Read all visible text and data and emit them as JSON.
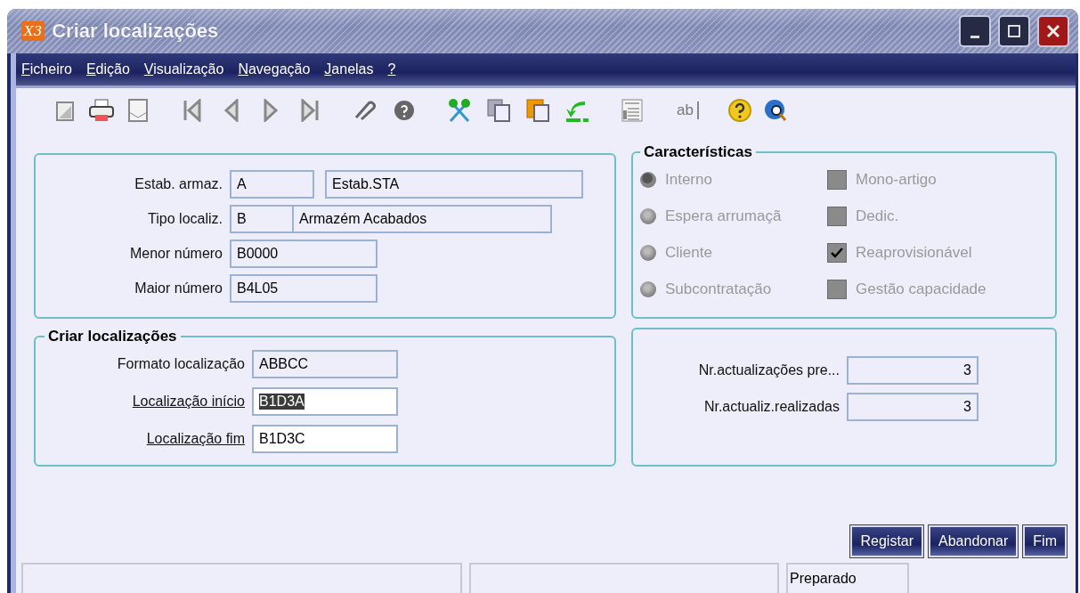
{
  "window": {
    "logo": "X3",
    "title": "Criar localizações"
  },
  "menu": [
    "Ficheiro",
    "Edição",
    "Visualização",
    "Navegação",
    "Janelas",
    "?"
  ],
  "toolbar": [
    {
      "kind": "page"
    },
    {
      "kind": "printer"
    },
    {
      "kind": "mail"
    },
    {
      "kind": "first"
    },
    {
      "kind": "prev"
    },
    {
      "kind": "next"
    },
    {
      "kind": "last"
    },
    {
      "kind": "clip"
    },
    {
      "kind": "help-grey"
    },
    {
      "kind": "scissors"
    },
    {
      "kind": "copy"
    },
    {
      "kind": "paste"
    },
    {
      "kind": "arrow"
    },
    {
      "kind": "form"
    },
    {
      "kind": "text",
      "label": "ab"
    },
    {
      "kind": "help"
    },
    {
      "kind": "globe"
    }
  ],
  "header_group": {
    "rows": [
      {
        "label": "Estab. armaz.",
        "kind": "pair",
        "values": [
          "A",
          "Estab.STA"
        ]
      },
      {
        "label": "Tipo localiz.",
        "kind": "joined",
        "values": [
          "B",
          "Armazém Acabados"
        ]
      },
      {
        "label": "Menor número",
        "kind": "single",
        "values": [
          "B0000"
        ]
      },
      {
        "label": "Maior número",
        "kind": "single",
        "values": [
          "B4L05"
        ]
      }
    ]
  },
  "characteristics": {
    "title": "Características",
    "radios": [
      {
        "label": "Interno",
        "selected": true
      },
      {
        "label": "Espera arrumaçã",
        "selected": false
      },
      {
        "label": "Cliente",
        "selected": false
      },
      {
        "label": "Subcontratação",
        "selected": false
      }
    ],
    "checkboxes": [
      {
        "label": "Mono-artigo",
        "checked": false
      },
      {
        "label": "Dedic.",
        "checked": false
      },
      {
        "label": "Reaprovisionável",
        "checked": true
      },
      {
        "label": "Gestão capacidade",
        "checked": false
      }
    ]
  },
  "create_group": {
    "title": "Criar localizações",
    "rows": [
      {
        "label": "Formato localização",
        "value": "ABBCC",
        "link": false,
        "editable": false,
        "highlighted": false
      },
      {
        "label": "Localização início",
        "value": "B1D3A",
        "link": true,
        "editable": true,
        "highlighted": true
      },
      {
        "label": "Localização fim",
        "value": "B1D3C",
        "link": true,
        "editable": true,
        "highlighted": false
      }
    ]
  },
  "counters": [
    {
      "label": "Nr.actualizações pre...",
      "value": "3"
    },
    {
      "label": "Nr.actualiz.realizadas",
      "value": "3"
    }
  ],
  "buttons": [
    "Registar",
    "Abandonar",
    "Fim"
  ],
  "status_bar": {
    "message": "Preparado"
  }
}
